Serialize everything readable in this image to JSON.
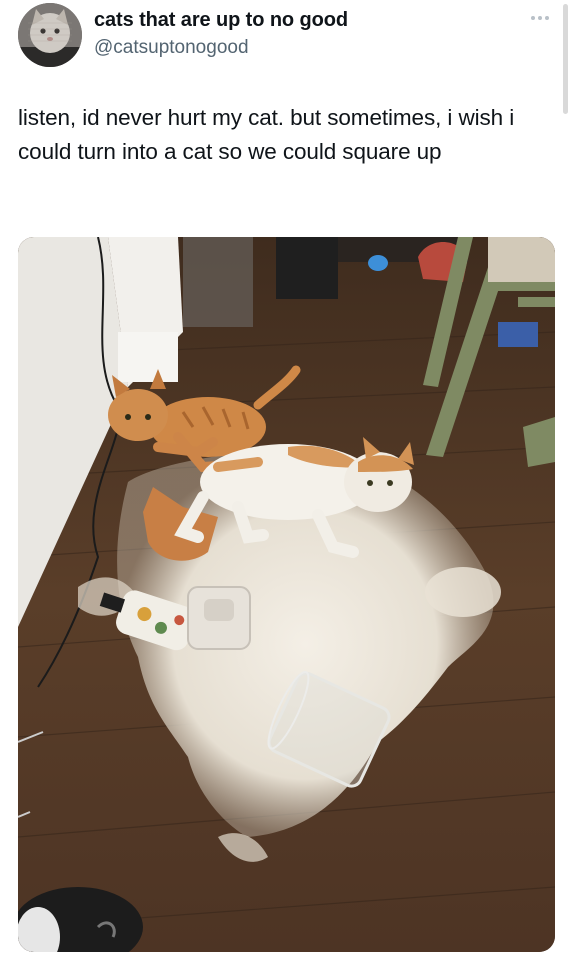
{
  "author": {
    "display_name": "cats that are up to no good",
    "handle": "@catsuptonogood",
    "avatar_icon": "cat-avatar-icon"
  },
  "menu": {
    "icon": "more-horizontal-icon"
  },
  "tweet": {
    "text": "listen, id never hurt my cat. but sometimes, i wish i could turn into a cat so we could square up"
  },
  "media": {
    "type": "photo"
  },
  "colors": {
    "text_primary": "#0f1419",
    "text_secondary": "#536471",
    "icon_muted": "#b9c1c8"
  }
}
